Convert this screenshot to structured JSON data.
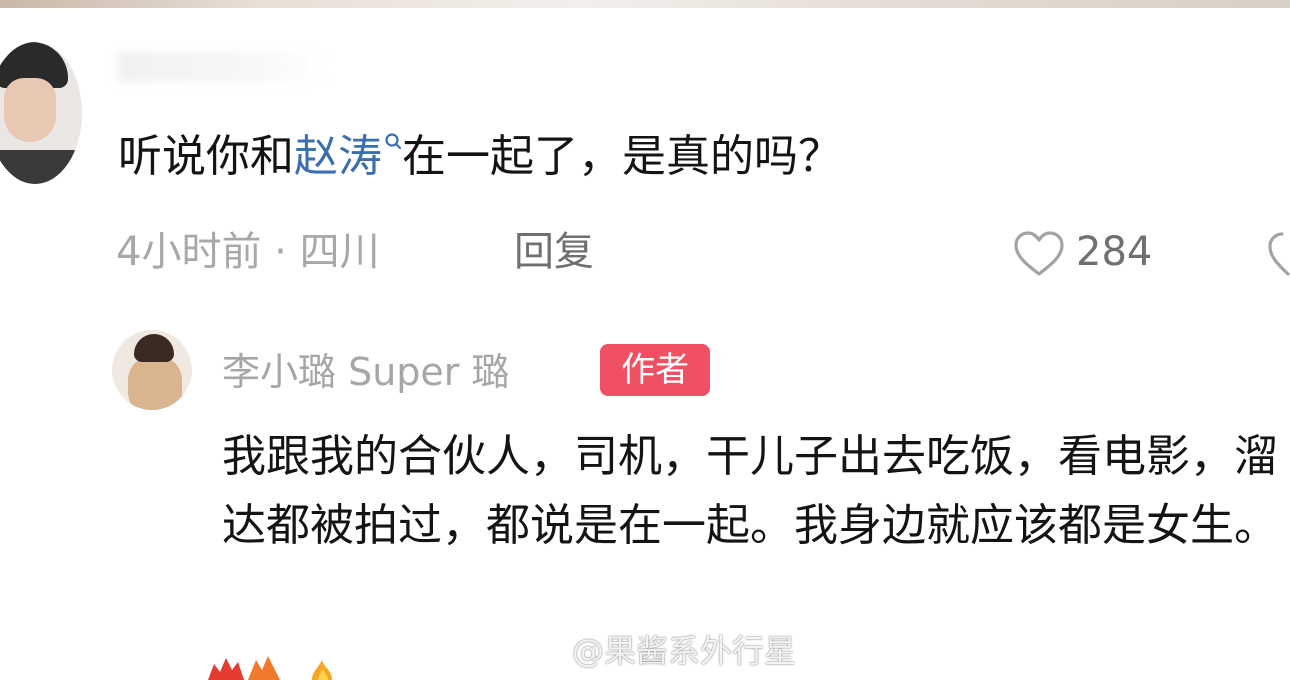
{
  "comment": {
    "text_before": "听说你和",
    "mention": "赵涛",
    "text_after": "在一起了，是真的吗？",
    "time_location": "4小时前 · 四川",
    "reply_label": "回复",
    "like_count": "284"
  },
  "reply": {
    "author_name": "李小璐 Super 璐",
    "badge_label": "作者",
    "text": "我跟我的合伙人，司机，干儿子出去吃饭，看电影，溜达都被拍过，都说是在一起。我身边就应该都是女生。"
  },
  "watermark": {
    "text": "@果酱系外行星"
  },
  "colors": {
    "mention": "#3a6fb0",
    "badge": "#ef5063",
    "meta": "#a8a8a8"
  },
  "icons": [
    "search-icon",
    "heart-icon",
    "weibo-logo-icon"
  ]
}
